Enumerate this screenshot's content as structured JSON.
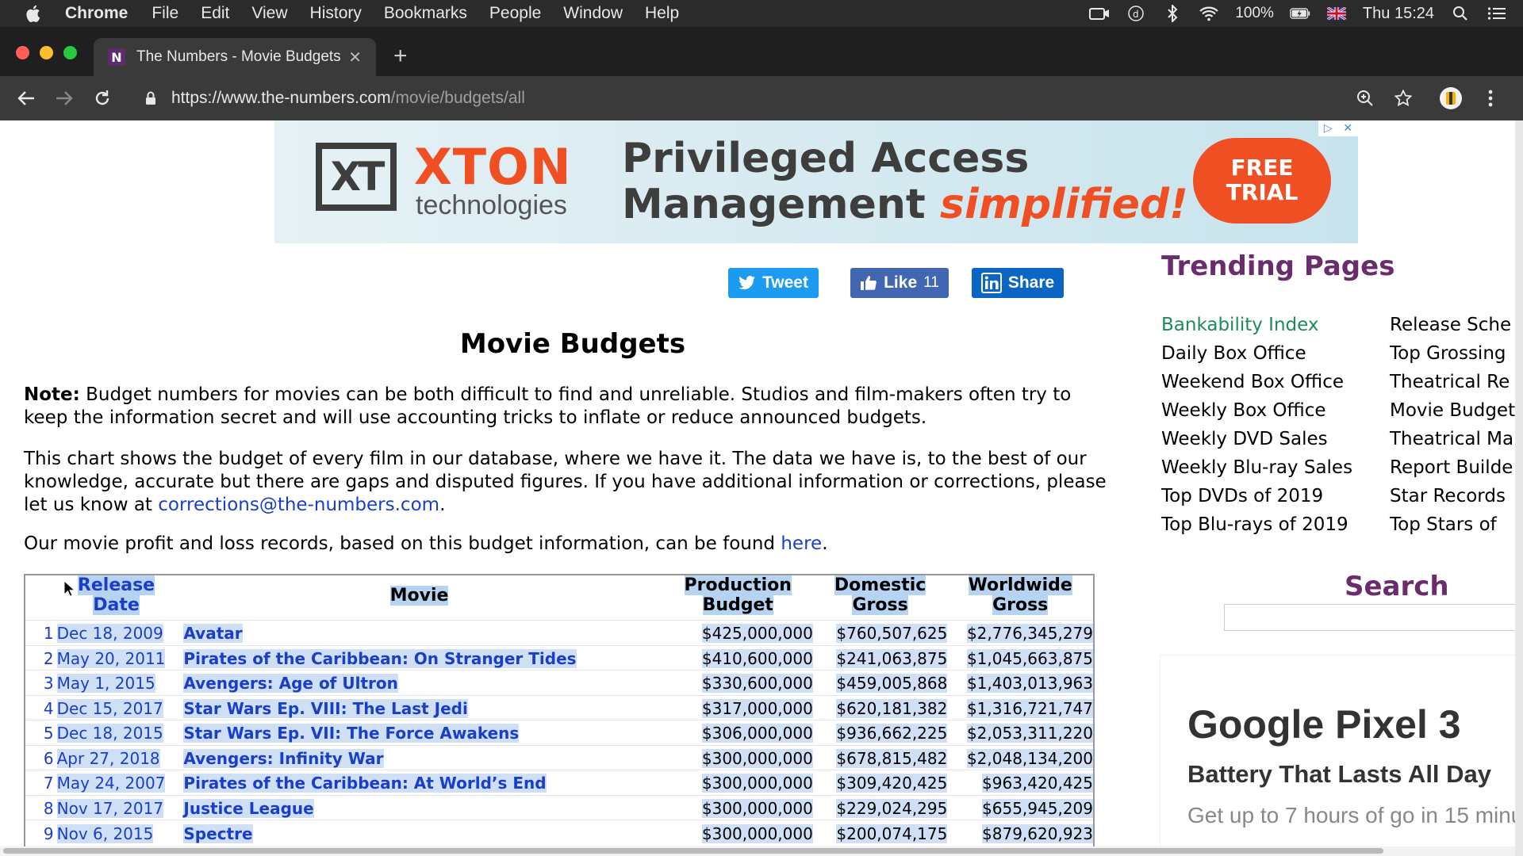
{
  "menubar": {
    "app": "Chrome",
    "items": [
      "File",
      "Edit",
      "View",
      "History",
      "Bookmarks",
      "People",
      "Window",
      "Help"
    ],
    "battery": "100%",
    "clock": "Thu 15:24"
  },
  "browser": {
    "tab_title": "The Numbers - Movie Budgets",
    "tab_favicon": "N",
    "url_host": "https://www.the-numbers.com",
    "url_path": "/movie/budgets/all"
  },
  "ad_banner": {
    "logo_letters": "XT",
    "brand": "XTON",
    "brand_sub": "technologies",
    "headline_line1": "Privileged Access",
    "headline_line2_plain": "Management ",
    "headline_line2_emphasis": "simplified!",
    "cta_line1": "FREE",
    "cta_line2": "TRIAL"
  },
  "share": {
    "tweet": "Tweet",
    "like": "Like",
    "like_count": "11",
    "share": "Share"
  },
  "page": {
    "title": "Movie Budgets",
    "note_label": "Note:",
    "note_text": " Budget numbers for movies can be both difficult to find and unreliable. Studios and film-makers often try to keep the information secret and will use accounting tricks to inflate or reduce announced budgets.",
    "chart_text": "This chart shows the budget of every film in our database, where we have it. The data we have is, to the best of our knowledge, accurate but there are gaps and disputed figures. If you have additional information or corrections, please let us know at ",
    "corrections_email": "corrections@the-numbers.com",
    "chart_text_end": ".",
    "profit_text": "Our movie profit and loss records, based on this budget information, can be found ",
    "profit_link": "here",
    "profit_end": "."
  },
  "table": {
    "headers": {
      "release_date_1": "Release",
      "release_date_2": "Date",
      "movie": "Movie",
      "production_1": "Production",
      "production_2": "Budget",
      "domestic_1": "Domestic",
      "domestic_2": "Gross",
      "worldwide_1": "Worldwide",
      "worldwide_2": "Gross"
    },
    "rows": [
      {
        "rank": "1",
        "date": "Dec 18, 2009",
        "movie": "Avatar",
        "production": "$425,000,000",
        "domestic": "$760,507,625",
        "worldwide": "$2,776,345,279"
      },
      {
        "rank": "2",
        "date": "May 20, 2011",
        "movie": "Pirates of the Caribbean: On Stranger Tides",
        "production": "$410,600,000",
        "domestic": "$241,063,875",
        "worldwide": "$1,045,663,875"
      },
      {
        "rank": "3",
        "date": "May 1, 2015",
        "movie": "Avengers: Age of Ultron",
        "production": "$330,600,000",
        "domestic": "$459,005,868",
        "worldwide": "$1,403,013,963"
      },
      {
        "rank": "4",
        "date": "Dec 15, 2017",
        "movie": "Star Wars Ep. VIII: The Last Jedi",
        "production": "$317,000,000",
        "domestic": "$620,181,382",
        "worldwide": "$1,316,721,747"
      },
      {
        "rank": "5",
        "date": "Dec 18, 2015",
        "movie": "Star Wars Ep. VII: The Force Awakens",
        "production": "$306,000,000",
        "domestic": "$936,662,225",
        "worldwide": "$2,053,311,220"
      },
      {
        "rank": "6",
        "date": "Apr 27, 2018",
        "movie": "Avengers: Infinity War",
        "production": "$300,000,000",
        "domestic": "$678,815,482",
        "worldwide": "$2,048,134,200"
      },
      {
        "rank": "7",
        "date": "May 24, 2007",
        "movie": "Pirates of the Caribbean: At World’s End",
        "production": "$300,000,000",
        "domestic": "$309,420,425",
        "worldwide": "$963,420,425"
      },
      {
        "rank": "8",
        "date": "Nov 17, 2017",
        "movie": "Justice League",
        "production": "$300,000,000",
        "domestic": "$229,024,295",
        "worldwide": "$655,945,209"
      },
      {
        "rank": "9",
        "date": "Nov 6, 2015",
        "movie": "Spectre",
        "production": "$300,000,000",
        "domestic": "$200,074,175",
        "worldwide": "$879,620,923"
      }
    ]
  },
  "sidebar": {
    "trending_title": "Trending Pages",
    "trending_col1": [
      "Bankability Index",
      "Daily Box Office",
      "Weekend Box Office",
      "Weekly Box Office",
      "Weekly DVD Sales",
      "Weekly Blu-ray Sales",
      "Top DVDs of 2019",
      "Top Blu-rays of 2019"
    ],
    "trending_col2": [
      "Release Sche",
      "Top Grossing",
      "Theatrical Re",
      "Movie Budget",
      "Theatrical Ma",
      "Report Builde",
      "Star Records",
      "Top Stars of "
    ],
    "search_title": "Search",
    "ad_title": "Google Pixel 3",
    "ad_subtitle": "Battery That Lasts All Day",
    "ad_body": "Get up to 7 hours of go in 15 minu"
  },
  "colors": {
    "site_purple": "#6b2c6e",
    "link_blue": "#1a3ec9",
    "highlight_blue": "#cfe0f6",
    "ad_orange": "#f04e23"
  }
}
